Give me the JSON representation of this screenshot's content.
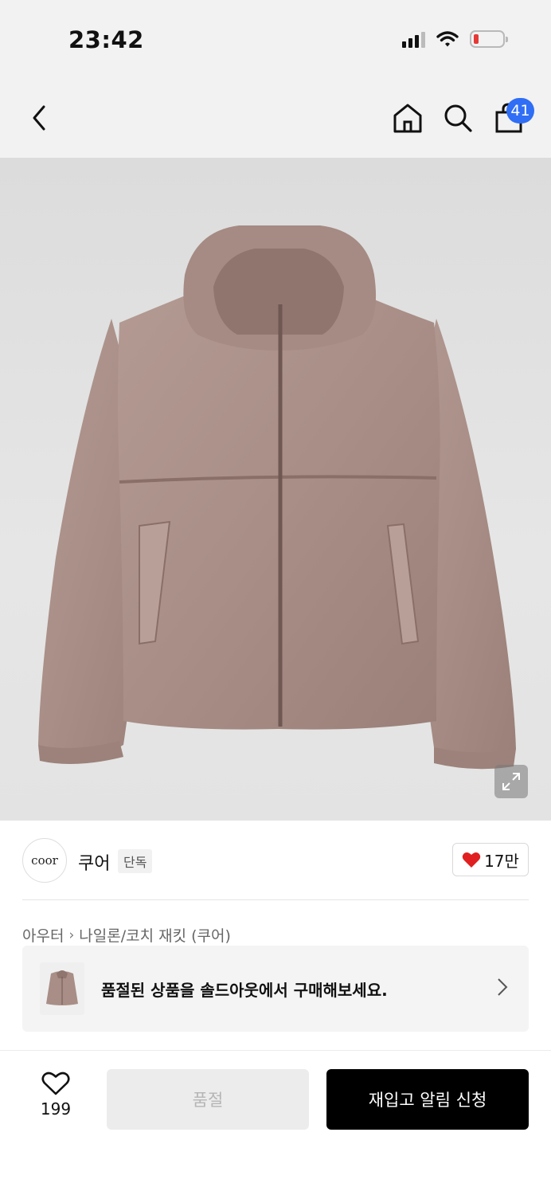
{
  "status_bar": {
    "time": "23:42"
  },
  "nav": {
    "cart_count": "41"
  },
  "brand": {
    "logo_text": "coor",
    "name": "쿠어",
    "tag": "단독",
    "likes": "17만"
  },
  "breadcrumb": {
    "category": "아우터",
    "subcategory": "나일론/코치 재킷 (쿠어)"
  },
  "soldout_banner": {
    "text": "품절된 상품을 솔드아웃에서 구매해보세요."
  },
  "bottom_bar": {
    "wish_count": "199",
    "soldout_label": "품절",
    "restock_label": "재입고 알림 신청"
  },
  "colors": {
    "badge": "#2f6ef5",
    "heart": "#e02020",
    "jacket": "#a88e86",
    "primary_button": "#000000"
  },
  "icons": [
    "back-icon",
    "home-icon",
    "search-icon",
    "shopping-bag-icon",
    "expand-icon",
    "heart-icon",
    "chevron-right-icon"
  ]
}
